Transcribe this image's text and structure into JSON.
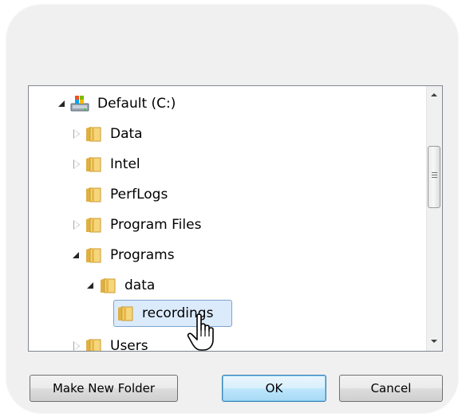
{
  "tree": {
    "nodes": [
      {
        "label": "Default (C:)",
        "icon": "drive-icon",
        "state": "expanded"
      },
      {
        "label": "Data",
        "icon": "folder-icon",
        "state": "collapsed"
      },
      {
        "label": "Intel",
        "icon": "folder-icon",
        "state": "collapsed"
      },
      {
        "label": "PerfLogs",
        "icon": "folder-icon",
        "state": "none"
      },
      {
        "label": "Program Files",
        "icon": "folder-icon",
        "state": "collapsed"
      },
      {
        "label": "Programs",
        "icon": "folder-icon",
        "state": "expanded"
      },
      {
        "label": "data",
        "icon": "folder-icon",
        "state": "expanded"
      },
      {
        "label": "recordings",
        "icon": "folder-icon",
        "state": "none",
        "selected": true
      },
      {
        "label": "Users",
        "icon": "folder-icon",
        "state": "collapsed"
      }
    ]
  },
  "buttons": {
    "make_new_folder": "Make New Folder",
    "ok": "OK",
    "cancel": "Cancel"
  },
  "colors": {
    "selection_fill": "#dcebfc",
    "selection_border": "#7da2ce",
    "default_button": "#bee6fd"
  },
  "cursor": "hand-pointer-icon"
}
